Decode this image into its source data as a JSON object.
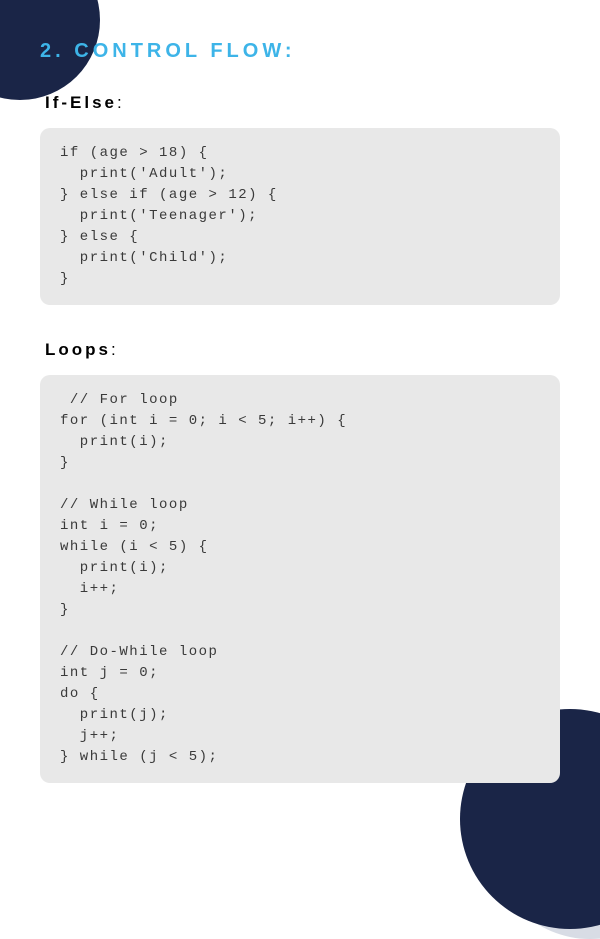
{
  "section": {
    "number": "2.",
    "title": "CONTROL FLOW:"
  },
  "subsections": [
    {
      "title": "If-Else",
      "colon": ":",
      "code": "if (age > 18) {\n  print('Adult');\n} else if (age > 12) {\n  print('Teenager');\n} else {\n  print('Child');\n}"
    },
    {
      "title": "Loops",
      "colon": ":",
      "code": " // For loop\nfor (int i = 0; i < 5; i++) {\n  print(i);\n}\n\n// While loop\nint i = 0;\nwhile (i < 5) {\n  print(i);\n  i++;\n}\n\n// Do-While loop\nint j = 0;\ndo {\n  print(j);\n  j++;\n} while (j < 5);"
    }
  ]
}
